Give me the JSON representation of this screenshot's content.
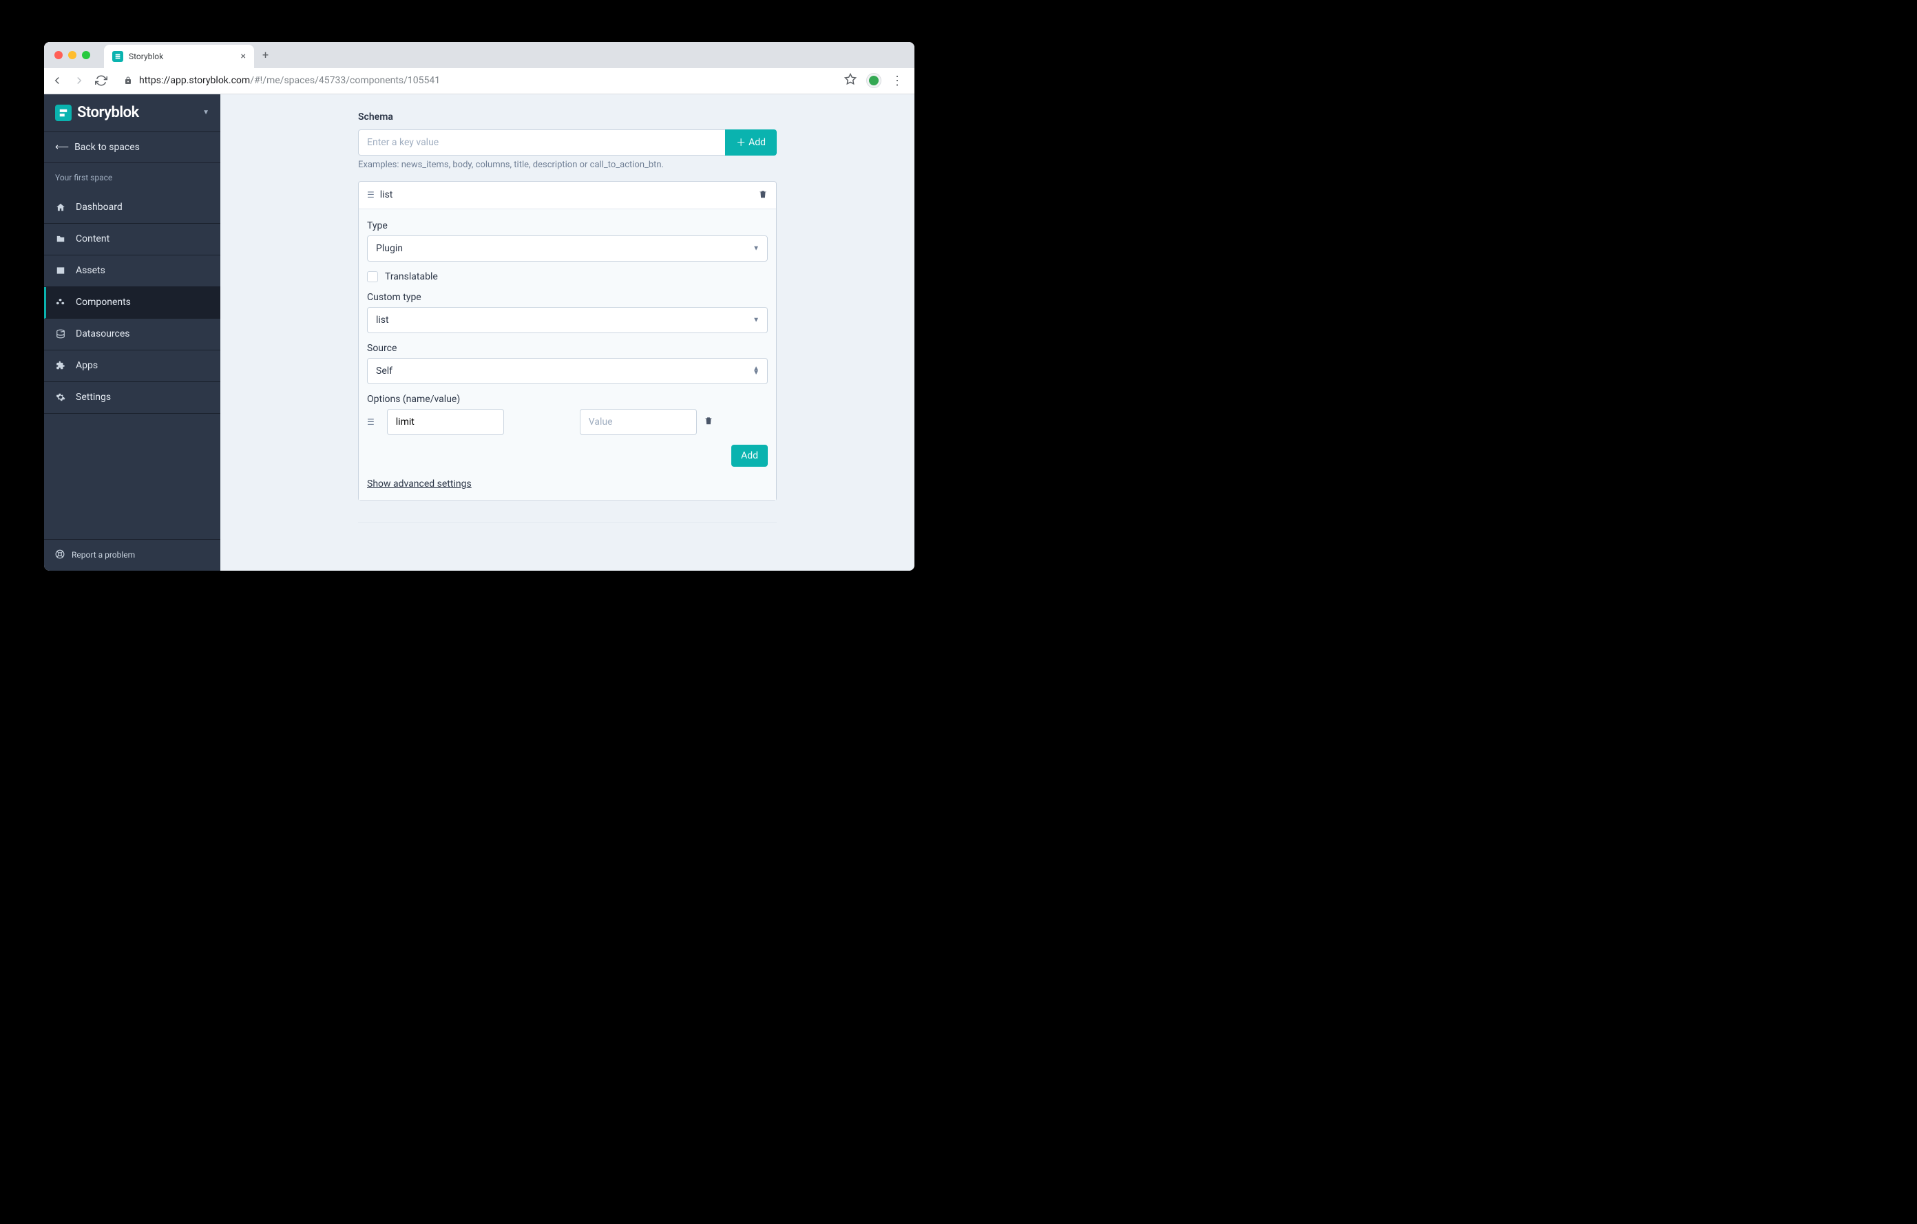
{
  "browser": {
    "tab_title": "Storyblok",
    "url_proto": "https://",
    "url_host": "app.storyblok.com",
    "url_path": "/#!/me/spaces/45733/components/105541"
  },
  "sidebar": {
    "brand": "Storyblok",
    "back_label": "Back to spaces",
    "space_name": "Your first space",
    "items": [
      {
        "label": "Dashboard"
      },
      {
        "label": "Content"
      },
      {
        "label": "Assets"
      },
      {
        "label": "Components"
      },
      {
        "label": "Datasources"
      },
      {
        "label": "Apps"
      },
      {
        "label": "Settings"
      }
    ],
    "footer_label": "Report a problem"
  },
  "main": {
    "schema_label": "Schema",
    "key_placeholder": "Enter a key value",
    "add_label": "Add",
    "examples_text": "Examples: news_items, body, columns, title, description or call_to_action_btn.",
    "field_name": "list",
    "type_label": "Type",
    "type_value": "Plugin",
    "translatable_label": "Translatable",
    "custom_type_label": "Custom type",
    "custom_type_value": "list",
    "source_label": "Source",
    "source_value": "Self",
    "options_label": "Options (name/value)",
    "option_name_value": "limit",
    "option_value_placeholder": "Value",
    "add_small_label": "Add",
    "advanced_label": "Show advanced settings"
  }
}
